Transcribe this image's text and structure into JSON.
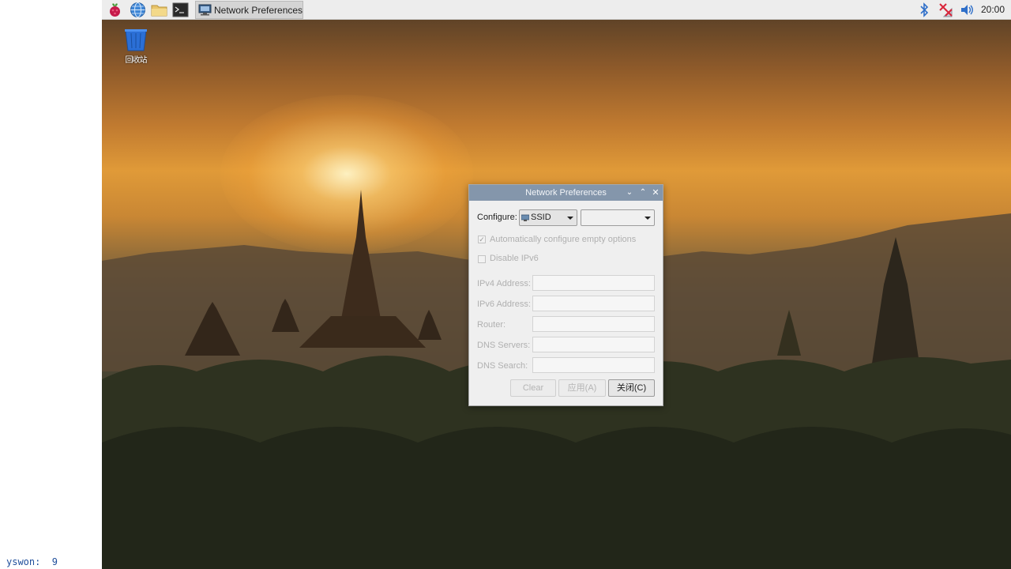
{
  "taskbar": {
    "window_title": "Network Preferences",
    "clock": "20:00",
    "icons": [
      "raspberry-menu-icon",
      "globe-browser-icon",
      "folder-icon",
      "terminal-icon",
      "bluetooth-icon",
      "network-disconnected-icon",
      "volume-icon"
    ]
  },
  "desktop": {
    "trash_label": "回收站"
  },
  "dialog": {
    "title": "Network Preferences",
    "configure_label": "Configure:",
    "configure_type": "SSID",
    "configure_value": "",
    "auto_configure": {
      "label": "Automatically configure empty options",
      "checked": true
    },
    "disable_ipv6": {
      "label": "Disable IPv6",
      "checked": false
    },
    "fields": [
      {
        "label": "IPv4 Address:",
        "value": ""
      },
      {
        "label": "IPv6 Address:",
        "value": ""
      },
      {
        "label": "Router:",
        "value": ""
      },
      {
        "label": "DNS Servers:",
        "value": ""
      },
      {
        "label": "DNS Search:",
        "value": ""
      }
    ],
    "buttons": {
      "clear": "Clear",
      "apply": "应用(A)",
      "close": "关闭(C)"
    }
  },
  "corner": {
    "text": "yswon:  9"
  }
}
